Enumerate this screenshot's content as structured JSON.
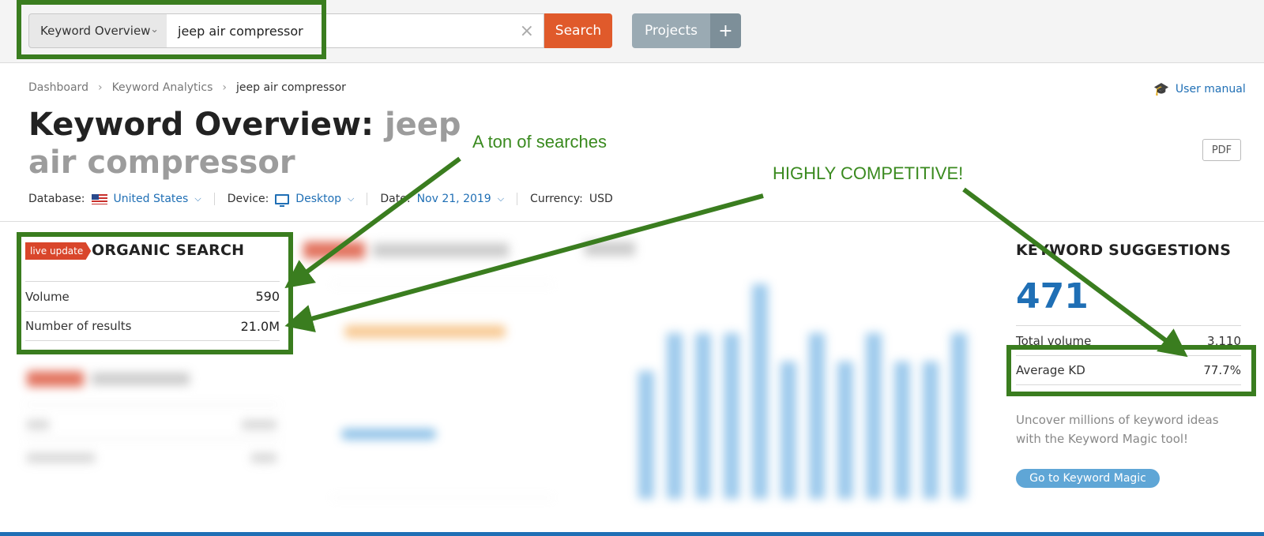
{
  "toolbar": {
    "tool_select": "Keyword Overview",
    "search_value": "jeep air compressor",
    "search_label": "Search",
    "projects_label": "Projects",
    "plus_label": "+"
  },
  "breadcrumb": [
    "Dashboard",
    "Keyword Analytics",
    "jeep air compressor"
  ],
  "user_manual": "User manual",
  "title": {
    "prefix": "Keyword Overview:",
    "keyword": "jeep air compressor"
  },
  "pdf_label": "PDF",
  "filters": {
    "database_label": "Database:",
    "database_value": "United States",
    "device_label": "Device:",
    "device_value": "Desktop",
    "date_label": "Date:",
    "date_value": "Nov 21, 2019",
    "currency_label": "Currency:",
    "currency_value": "USD"
  },
  "organic": {
    "badge": "live update",
    "title": "ORGANIC SEARCH",
    "rows": [
      {
        "label": "Volume",
        "value": "590"
      },
      {
        "label": "Number of results",
        "value": "21.0M"
      }
    ]
  },
  "suggestions": {
    "title": "KEYWORD SUGGESTIONS",
    "count": "471",
    "rows": [
      {
        "label": "Total volume",
        "value": "3,110"
      },
      {
        "label": "Average KD",
        "value": "77.7%"
      }
    ],
    "promo": "Uncover millions of keyword ideas with the Keyword Magic tool!",
    "button": "Go to Keyword Magic"
  },
  "annotations": {
    "searches": "A ton of searches",
    "competitive": "HIGHLY COMPETITIVE!"
  },
  "colors": {
    "accent_blue": "#1f6fb5",
    "search_orange": "#e05a2b",
    "annotation_green": "#3a7d1f"
  },
  "blurred_chart": {
    "trend_bar_levels": [
      0.58,
      0.75,
      0.75,
      0.75,
      0.97,
      0.62,
      0.75,
      0.62,
      0.75,
      0.62,
      0.62,
      0.75
    ]
  }
}
